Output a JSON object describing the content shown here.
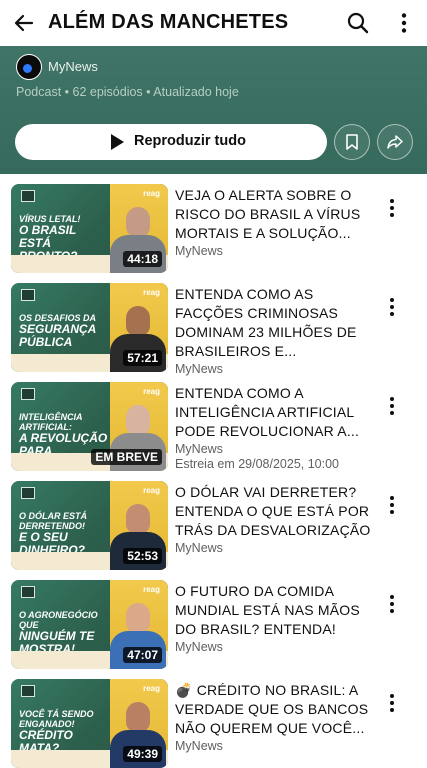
{
  "header": {
    "title": "ALÉM DAS MANCHETES",
    "back_icon": "arrow-left-icon",
    "search_icon": "search-icon",
    "more_icon": "more-vertical-icon"
  },
  "playlist": {
    "channel": "MyNews",
    "meta": "Podcast • 62 episódios • Atualizado hoje",
    "play_all_label": "Reproduzir tudo",
    "save_icon": "bookmark-icon",
    "share_icon": "share-icon",
    "accent_color": "#356a5c"
  },
  "videos": [
    {
      "title": "VEJA O ALERTA SOBRE O RISCO DO BRASIL A VÍRUS MORTAIS E A SOLUÇÃO...",
      "channel": "MyNews",
      "duration": "44:18",
      "thumb_headline": "VÍRUS LETAL!",
      "thumb_headline2": "O BRASIL ESTÁ PRONTO?",
      "extra": ""
    },
    {
      "title": "ENTENDA COMO AS FACÇÕES CRIMINOSAS DOMINAM 23 MILHÕES DE BRASILEIROS E...",
      "channel": "MyNews",
      "duration": "57:21",
      "thumb_headline": "OS DESAFIOS DA",
      "thumb_headline2": "SEGURANÇA PÚBLICA",
      "extra": ""
    },
    {
      "title": "ENTENDA COMO A INTELIGÊNCIA ARTIFICIAL PODE REVOLUCIONAR A...",
      "channel": "MyNews",
      "duration": "EM BREVE",
      "thumb_headline": "INTELIGÊNCIA ARTIFICIAL:",
      "thumb_headline2": "A REVOLUÇÃO PARA EMPREENDEDORES!",
      "extra": "Estreia em 29/08/2025, 10:00"
    },
    {
      "title": "O DÓLAR VAI DERRETER? ENTENDA O QUE ESTÁ POR TRÁS DA DESVALORIZAÇÃO",
      "channel": "MyNews",
      "duration": "52:53",
      "thumb_headline": "O DÓLAR ESTÁ DERRETENDO!",
      "thumb_headline2": "E O SEU DINHEIRO?",
      "extra": ""
    },
    {
      "title": "O FUTURO DA COMIDA MUNDIAL ESTÁ NAS MÃOS DO BRASIL? ENTENDA!",
      "channel": "MyNews",
      "duration": "47:07",
      "thumb_headline": "O AGRONEGÓCIO QUE",
      "thumb_headline2": "NINGUÉM TE MOSTRA!",
      "extra": ""
    },
    {
      "title": "💣 CRÉDITO NO BRASIL: A VERDADE QUE OS BANCOS NÃO QUEREM QUE VOCÊ...",
      "channel": "MyNews",
      "duration": "49:39",
      "thumb_headline": "VOCÊ TÁ SENDO ENGANADO!",
      "thumb_headline2": "CRÉDITO MATA?",
      "extra": ""
    }
  ]
}
